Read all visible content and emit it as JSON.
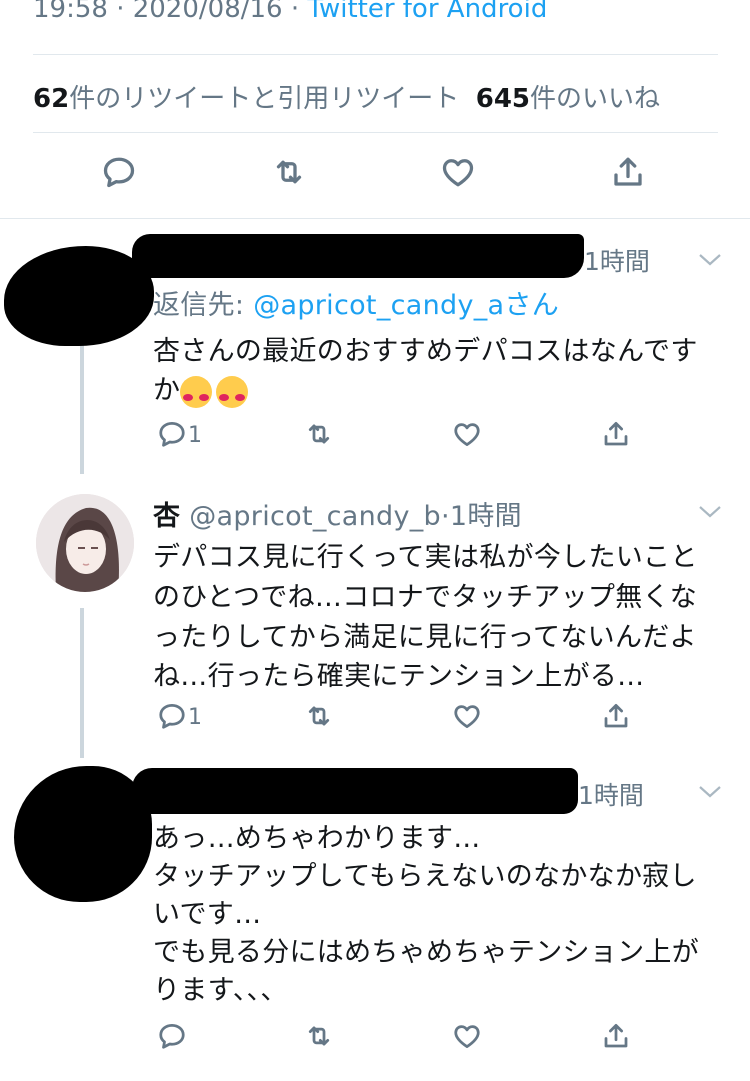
{
  "header": {
    "timestamp": "19:58 · 2020/08/16 · ",
    "via": "Twitter for Android"
  },
  "stats": {
    "retweets_count": "62",
    "retweets_label": "件のリツイートと引用リツイート",
    "likes_count": "645",
    "likes_label": "件のいいね"
  },
  "replies": [
    {
      "time": "1時間",
      "reply_to_label": "返信先: ",
      "reply_to_handle": "@apricot_candy_a",
      "reply_to_suffix": "さん",
      "lines": [
        "杏さんの最近のおすすめデパコスはなんです",
        "か"
      ],
      "reply_count": "1"
    },
    {
      "name": "杏",
      "handle": "@apricot_candy_b",
      "time": "1時間",
      "lines": [
        "デパコス見に行くって実は私が今したいこと",
        "のひとつでね…コロナでタッチアップ無くな",
        "ったりしてから満足に見に行ってないんだよ",
        "ね…行ったら確実にテンション上がる…"
      ],
      "reply_count": "1"
    },
    {
      "time": "1時間",
      "lines": [
        "あっ…めちゃわかります…",
        "タッチアップしてもらえないのなかなか寂し",
        "いです…",
        "でも見る分にはめちゃめちゃテンション上が",
        "ります、、、"
      ]
    }
  ],
  "icons": [
    "reply-icon",
    "retweet-icon",
    "like-icon",
    "share-icon",
    "chevron-down-icon"
  ],
  "colors": {
    "accent": "#1da1f2",
    "muted": "#657786",
    "divider": "#e1e8ed"
  }
}
